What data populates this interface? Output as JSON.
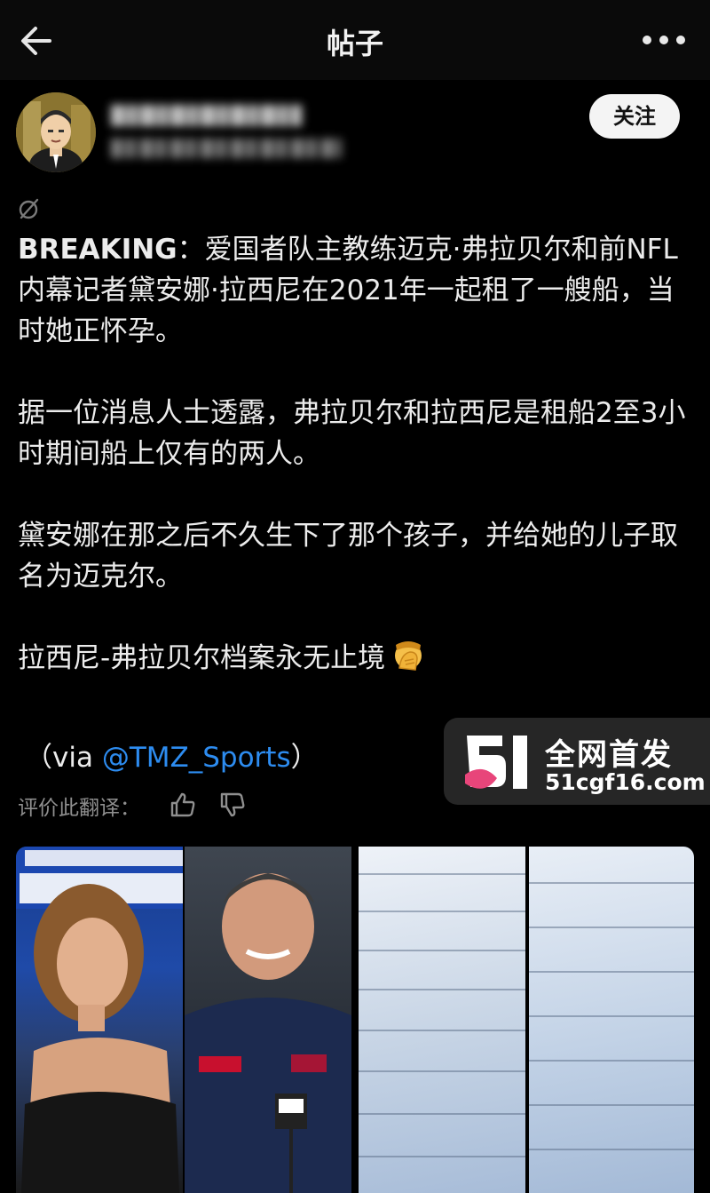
{
  "header": {
    "title": "帖子"
  },
  "author": {
    "follow_label": "关注"
  },
  "post": {
    "lead_bold": "BREAKING",
    "lead_sep": "：",
    "lead_text": "爱国者队主教练迈克·弗拉贝尔和前NFL内幕记者黛安娜·拉西尼在2021年一起租了一艘船，当时她正怀孕。",
    "para2": "据一位消息人士透露，弗拉贝尔和拉西尼是租船2至3小时期间船上仅有的两人。",
    "para3": "黛安娜在那之后不久生下了那个孩子，并给她的儿子取名为迈克尔。",
    "para4": "拉西尼-弗拉贝尔档案永无止境",
    "via_prefix": "（via ",
    "via_link": "@TMZ_Sports",
    "via_suffix": "）"
  },
  "translation_rating": {
    "label": "评价此翻译："
  },
  "watermark": {
    "title": "全网首发",
    "url": "51cgf16.com"
  },
  "icons": {
    "back": "arrow-left-icon",
    "more": "more-horizontal-icon",
    "translate": "translate-icon",
    "thumb_up": "thumb-up-icon",
    "thumb_down": "thumb-down-icon",
    "emoji": "face-palm-emoji"
  },
  "colors": {
    "background": "#000000",
    "link": "#2d8cf0",
    "follow_bg": "#f4f4f4"
  }
}
